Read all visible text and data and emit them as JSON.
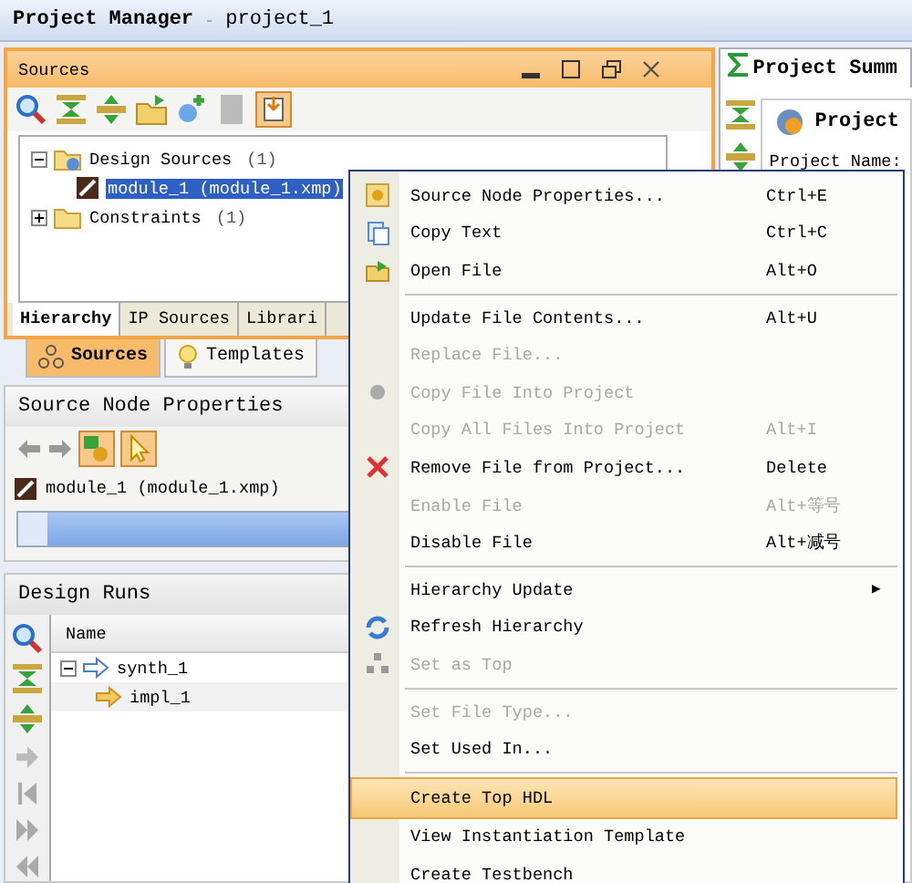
{
  "title_bar": {
    "title": "Project Manager",
    "separator": "-",
    "project": "project_1"
  },
  "sources_panel": {
    "title": "Sources",
    "tree": [
      {
        "label": "Design Sources",
        "count": "(1)",
        "expanded": true,
        "children": [
          {
            "label": "module_1 (module_1.xmp)",
            "selected": true
          }
        ]
      },
      {
        "label": "Constraints",
        "count": "(1)",
        "expanded": false
      }
    ],
    "view_tabs": [
      {
        "label": "Hierarchy",
        "selected": true
      },
      {
        "label": "IP Sources",
        "selected": false
      },
      {
        "label": "Librari",
        "selected": false
      }
    ],
    "bottom_tabs": [
      {
        "label": "Sources",
        "selected": true
      },
      {
        "label": "Templates",
        "selected": false
      }
    ]
  },
  "properties_panel": {
    "title": "Source Node Properties",
    "item": "module_1 (module_1.xmp)"
  },
  "design_runs": {
    "title": "Design Runs",
    "column": "Name",
    "runs": [
      {
        "label": "synth_1",
        "expanded": true,
        "children": [
          {
            "label": "impl_1"
          }
        ]
      }
    ]
  },
  "summary_panel": {
    "tab": "Project Summ",
    "heading": "Project",
    "label": "Project Name:"
  },
  "context_menu": {
    "items": [
      {
        "kind": "item",
        "label": "Source Node Properties...",
        "shortcut": "Ctrl+E",
        "disabled": false,
        "selected": false
      },
      {
        "kind": "item",
        "label": "Copy Text",
        "shortcut": "Ctrl+C",
        "disabled": false,
        "selected": false
      },
      {
        "kind": "item",
        "label": "Open File",
        "shortcut": "Alt+O",
        "disabled": false,
        "selected": false
      },
      {
        "kind": "separator"
      },
      {
        "kind": "item",
        "label": "Update File Contents...",
        "shortcut": "Alt+U",
        "disabled": false,
        "selected": false
      },
      {
        "kind": "item",
        "label": "Replace File...",
        "disabled": true,
        "selected": false
      },
      {
        "kind": "item",
        "label": "Copy File Into Project",
        "disabled": true,
        "selected": false
      },
      {
        "kind": "item",
        "label": "Copy All Files Into Project",
        "shortcut": "Alt+I",
        "disabled": true,
        "selected": false
      },
      {
        "kind": "item",
        "label": "Remove File from Project...",
        "shortcut": "Delete",
        "disabled": false,
        "selected": false
      },
      {
        "kind": "item",
        "label": "Enable File",
        "shortcut": "Alt+等号",
        "disabled": true,
        "selected": false
      },
      {
        "kind": "item",
        "label": "Disable File",
        "shortcut": "Alt+减号",
        "disabled": false,
        "selected": false
      },
      {
        "kind": "separator"
      },
      {
        "kind": "submenu",
        "label": "Hierarchy Update",
        "arrow": "▶",
        "disabled": false,
        "selected": false
      },
      {
        "kind": "item",
        "label": "Refresh Hierarchy",
        "disabled": false,
        "selected": false
      },
      {
        "kind": "item",
        "label": "Set as Top",
        "disabled": true,
        "selected": false
      },
      {
        "kind": "separator"
      },
      {
        "kind": "item",
        "label": "Set File Type...",
        "disabled": true,
        "selected": false
      },
      {
        "kind": "item",
        "label": "Set Used In...",
        "disabled": false,
        "selected": false
      },
      {
        "kind": "separator"
      },
      {
        "kind": "item",
        "label": "Create Top HDL",
        "disabled": false,
        "selected": true
      },
      {
        "kind": "item",
        "label": "View Instantiation Template",
        "disabled": false,
        "selected": false
      },
      {
        "kind": "item",
        "label": "Create Testbench",
        "disabled": false,
        "selected": false
      }
    ]
  }
}
